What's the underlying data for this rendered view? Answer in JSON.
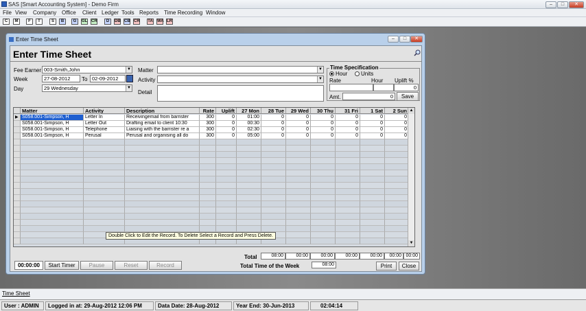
{
  "app": {
    "title": "SAS [Smart Accounting System] - Demo Firm",
    "min": "–",
    "max": "□",
    "close": "✕"
  },
  "menu": [
    "File",
    "View",
    "Company",
    "Office",
    "Client",
    "Ledger",
    "Tools",
    "Reports",
    "Time Recording",
    "Window"
  ],
  "toolbar": [
    "C",
    "M",
    "F",
    "T",
    "S",
    "B",
    "G",
    "GL",
    "CR",
    "D",
    "DB",
    "CB",
    "CR",
    "TA",
    "WA",
    "LR"
  ],
  "window": {
    "title": "Enter Time Sheet",
    "heading": "Enter Time Sheet",
    "search_icon": "magnifier-icon"
  },
  "form": {
    "fee_earner_label": "Fee Earner",
    "fee_earner": "003-Smith,John",
    "week_label": "Week",
    "week_from": "27-08-2012",
    "to_label": "To",
    "week_to": "02-09-2012",
    "day_label": "Day",
    "day": "29 Wednesday",
    "matter_label": "Matter",
    "matter": "",
    "activity_label": "Activity",
    "activity": "",
    "detail_label": "Detail",
    "detail": ""
  },
  "timespec": {
    "title": "Time Specification",
    "hour": "Hour",
    "units": "Units",
    "rate_label": "Rate",
    "hour_col": "Hour",
    "uplift_col": "Uplift %",
    "uplift_val": "0",
    "amt_label": "Amt.",
    "amt_val": "0",
    "save": "Save"
  },
  "grid": {
    "headers": [
      "Matter",
      "Activity",
      "Description",
      "Rate",
      "Uplift",
      "27 Mon",
      "28 Tue",
      "29 Wed",
      "30 Thu",
      "31 Fri",
      "1 Sat",
      "2 Sun"
    ],
    "rows": [
      [
        "S058.001-Simpson, H",
        "Letter In",
        "Receivingemail from barrister",
        "300",
        "0",
        "01:00",
        "0",
        "0",
        "0",
        "0",
        "0",
        "0"
      ],
      [
        "S058.001-Simpson, H",
        "Letter Out",
        "Drafting email to client 10:30",
        "300",
        "0",
        "00:30",
        "0",
        "0",
        "0",
        "0",
        "0",
        "0"
      ],
      [
        "S058.001-Simpson, H",
        "Telephone",
        "Liaising with the barrister re a",
        "300",
        "0",
        "02:30",
        "0",
        "0",
        "0",
        "0",
        "0",
        "0"
      ],
      [
        "S058.001-Simpson, H",
        "Perusal",
        "Perusal and organising all do",
        "300",
        "0",
        "05:00",
        "0",
        "0",
        "0",
        "0",
        "0",
        "0"
      ]
    ]
  },
  "tooltip": "Double Click to Edit the Record. To Delete Select a Record and Press Delete.",
  "totals": {
    "total_label": "Total",
    "values": [
      "08:00",
      "00:00",
      "00:00",
      "00:00",
      "00:00",
      "00:00",
      "00:00"
    ],
    "week_label": "Total Time of the Week",
    "week_value": "08:00"
  },
  "timer": {
    "display": "00:00:00",
    "start": "Start Timer",
    "pause": "Pause",
    "reset": "Reset",
    "record": "Record"
  },
  "buttons": {
    "print": "Print",
    "close": "Close"
  },
  "tabs": {
    "active": "Time Sheet"
  },
  "status": {
    "user": "User : ADMIN",
    "login": "Logged in at: 29-Aug-2012 12:06 PM",
    "data_date": "Data Date: 28-Aug-2012",
    "year_end": "Year End: 30-Jun-2013",
    "clock": "02:04:14"
  }
}
